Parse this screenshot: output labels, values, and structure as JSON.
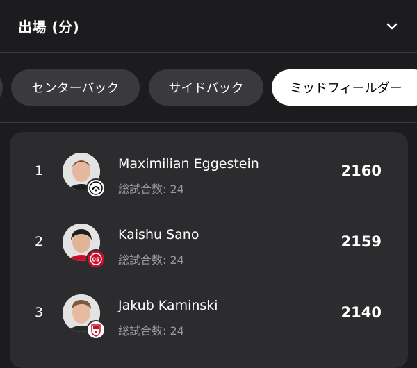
{
  "header": {
    "title": "出場 (分)",
    "toggle_icon": "chevron-down-icon"
  },
  "filters": [
    {
      "label": "センターバック",
      "active": false
    },
    {
      "label": "サイドバック",
      "active": false
    },
    {
      "label": "ミッドフィールダー",
      "active": true
    }
  ],
  "players": [
    {
      "rank": "1",
      "name": "Maximilian Eggestein",
      "matches": "総試合数: 24",
      "value": "2160",
      "club_icon": "freiburg-crest-icon"
    },
    {
      "rank": "2",
      "name": "Kaishu Sano",
      "matches": "総試合数: 24",
      "value": "2159",
      "club_icon": "mainz-05-crest-icon"
    },
    {
      "rank": "3",
      "name": "Jakub Kaminski",
      "matches": "総試合数: 24",
      "value": "2140",
      "club_icon": "koln-crest-icon"
    }
  ]
}
